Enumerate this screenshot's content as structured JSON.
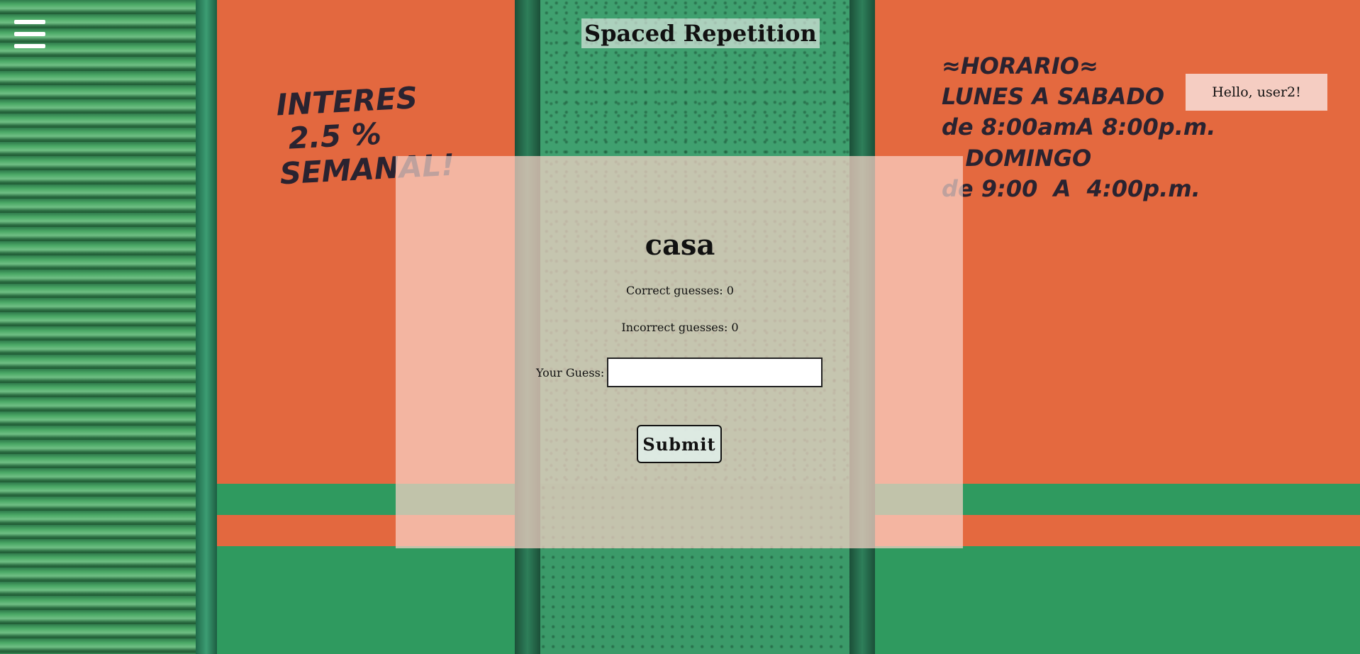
{
  "header": {
    "title": "Spaced Repetition",
    "menu_icon": "hamburger-menu-icon"
  },
  "user": {
    "greeting": "Hello, user2!"
  },
  "background_sign": {
    "left_lines": "INTERES\n 2.5 %\nSEMANAL!",
    "right_lines": "≈HORARIO≈\nLUNES A SABADO\nde 8:00amA 8:00p.m.\n   DOMINGO\nde 9:00  A  4:00p.m."
  },
  "card": {
    "word": "casa",
    "correct_label": "Correct guesses: 0",
    "incorrect_label": "Incorrect guesses: 0",
    "guess_label": "Your Guess:",
    "guess_value": "",
    "submit_label": "Submit"
  },
  "colors": {
    "accent_white": "#ffffff",
    "card_bg": "#fad2c8",
    "text": "#111111"
  }
}
